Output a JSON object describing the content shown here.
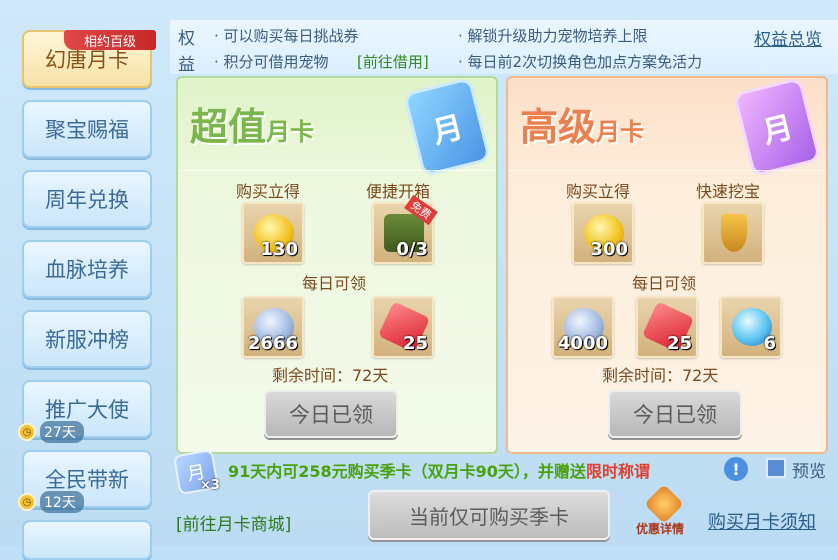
{
  "sidebar": {
    "items": [
      {
        "label": "幻唐月卡",
        "active": true
      },
      {
        "label": "聚宝赐福"
      },
      {
        "label": "周年兑换"
      },
      {
        "label": "血脉培养"
      },
      {
        "label": "新服冲榜"
      },
      {
        "label": "推广大使",
        "timer": "27天"
      },
      {
        "label": "全民带新",
        "timer": "12天"
      }
    ],
    "ribbon": "相约百级"
  },
  "benefits": {
    "title_1": "权",
    "title_2": "益",
    "row1_left": "· 可以购买每日挑战券",
    "row1_right": "· 解锁升级助力宠物培养上限",
    "row2_left_a": "· 积分可借用宠物",
    "row2_left_link": "[前往借用]",
    "row2_right": "· 每日前2次切换角色加点方案免活力",
    "summary_link": "权益总览"
  },
  "cards": {
    "value": {
      "title_big": "超值",
      "title_small": "月卡",
      "moon_char": "月",
      "buy_label": "购买立得",
      "quick_label": "便捷开箱",
      "free_tag": "免费",
      "buy_item": "130",
      "quick_item": "0/3",
      "daily_label": "每日可领",
      "daily": [
        "2666",
        "25"
      ],
      "remaining": "剩余时间：72天",
      "claim_button": "今日已领"
    },
    "premium": {
      "title_big": "高级",
      "title_small": "月卡",
      "moon_char": "月",
      "buy_label": "购买立得",
      "quick_label": "快速挖宝",
      "buy_item": "300",
      "daily_label": "每日可领",
      "daily": [
        "4000",
        "25",
        "6"
      ],
      "remaining": "剩余时间：72天",
      "claim_button": "今日已领"
    }
  },
  "promo": {
    "badge": "×3",
    "text_a": "91天内可258元购买季卡（双月卡90天），并赠送",
    "text_red": "限时称谓",
    "preview_label": "预览"
  },
  "footer": {
    "shop_link": "[前往月卡商城]",
    "buy_button": "当前仅可购买季卡",
    "discount_label": "优惠详情",
    "notice_link": "购买月卡须知"
  }
}
